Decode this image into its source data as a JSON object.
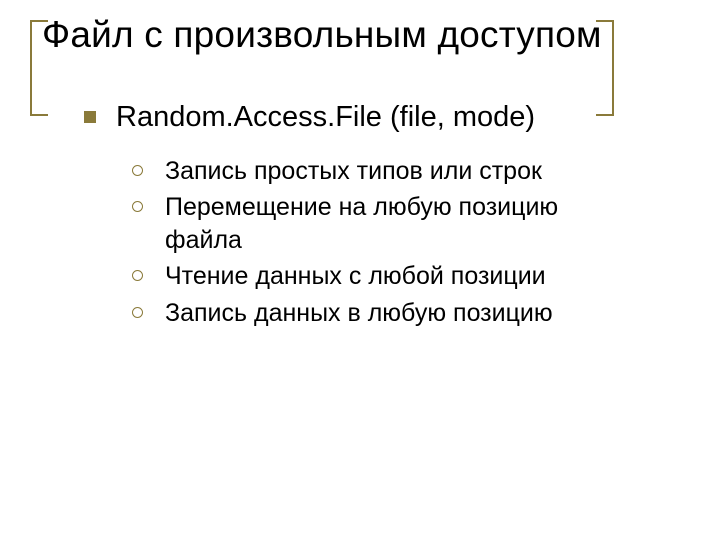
{
  "title": "Файл с произвольным доступом",
  "accent": "#8a7a3a",
  "main": {
    "heading": "Random.Access.File (file, mode)",
    "items": [
      "Запись простых типов или строк",
      "Перемещение на любую позицию файла",
      "Чтение данных с любой позиции",
      "Запись данных в любую позицию"
    ]
  }
}
